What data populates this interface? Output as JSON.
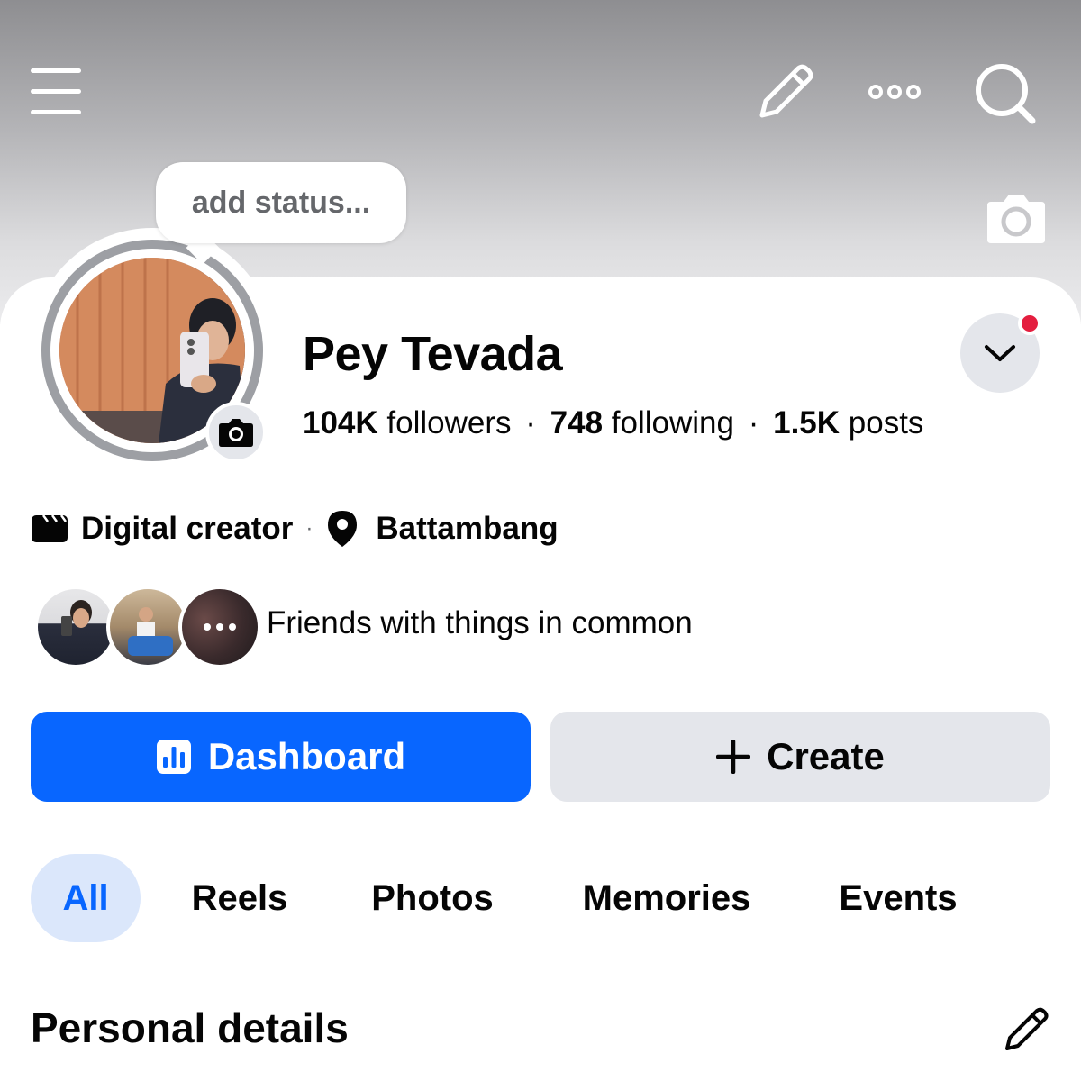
{
  "header": {
    "icons": [
      "menu-icon",
      "edit-icon",
      "more-icon",
      "search-icon"
    ],
    "cover_camera_icon": "camera-icon"
  },
  "status": {
    "placeholder": "add status..."
  },
  "profile": {
    "name": "Pey Tevada",
    "followers_count": "104K",
    "followers_label": "followers",
    "following_count": "748",
    "following_label": "following",
    "posts_count": "1.5K",
    "posts_label": "posts",
    "separator": "·",
    "notification_dot_color": "#e41e3f"
  },
  "info": {
    "category": "Digital creator",
    "separator": "·",
    "location": "Battambang"
  },
  "friends": {
    "text": "Friends with things in common"
  },
  "actions": {
    "dashboard_label": "Dashboard",
    "create_label": "Create",
    "accent_color": "#0866ff"
  },
  "tabs": [
    {
      "label": "All",
      "active": true
    },
    {
      "label": "Reels",
      "active": false
    },
    {
      "label": "Photos",
      "active": false
    },
    {
      "label": "Memories",
      "active": false
    },
    {
      "label": "Events",
      "active": false
    }
  ],
  "sections": {
    "personal_details_title": "Personal details"
  }
}
